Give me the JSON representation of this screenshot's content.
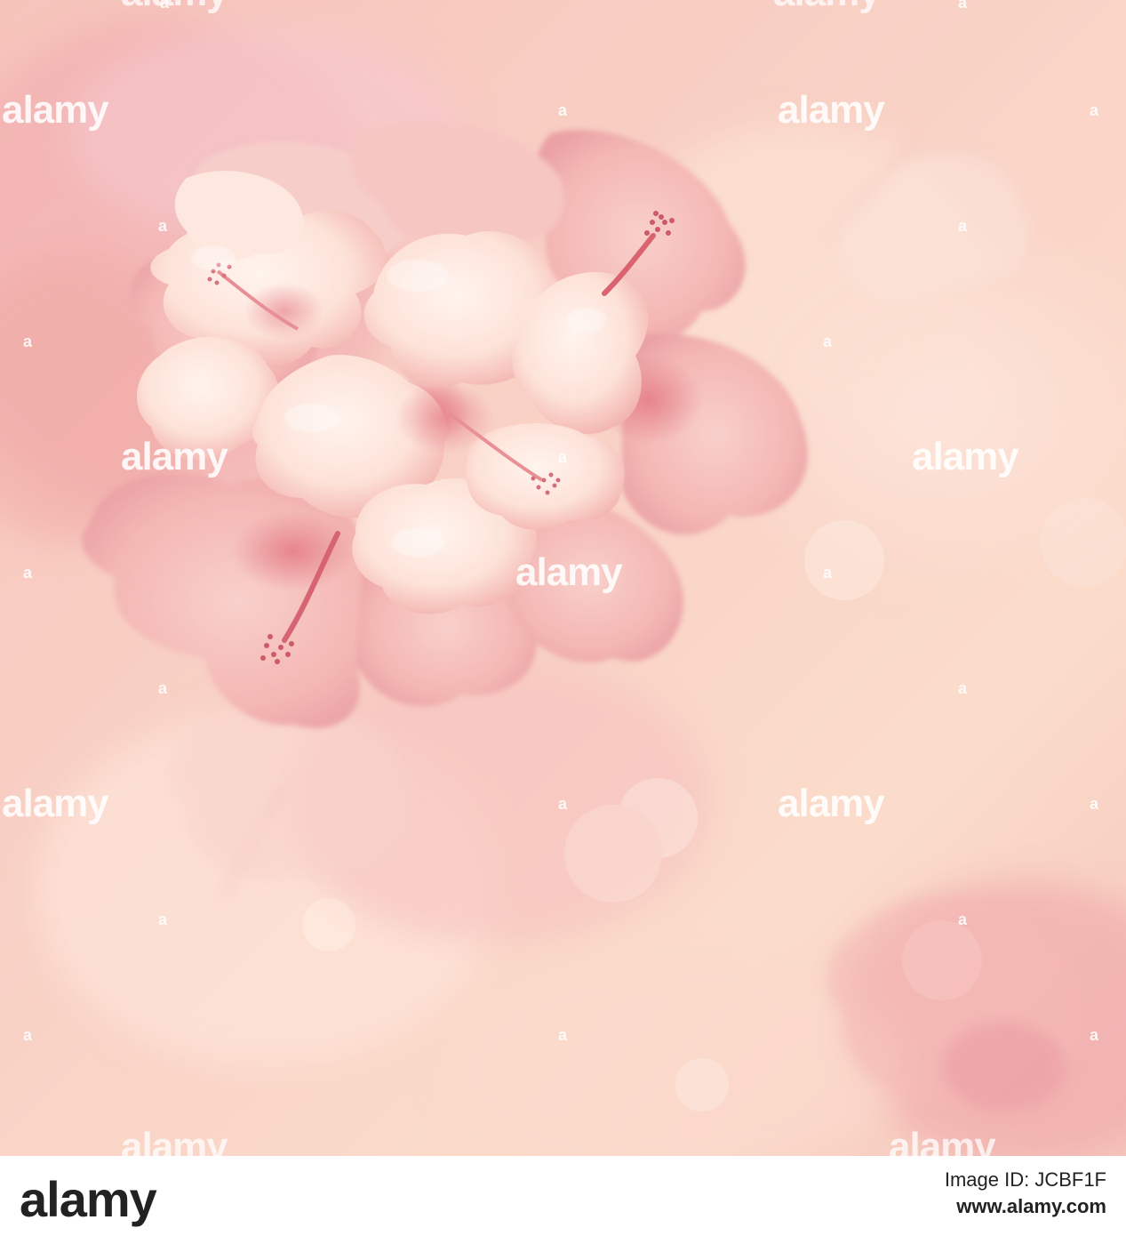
{
  "image": {
    "description_colors": {
      "background_light": "#fbdcc9",
      "background_pink": "#f3b9b2",
      "petal_light": "#fdeee6",
      "petal_shadow": "#e8a0a0",
      "stamen": "#d25a6a"
    }
  },
  "watermark": {
    "text": "alamy",
    "code": "a"
  },
  "footer": {
    "logo": "alamy",
    "id_label": "Image ID: JCBF1F",
    "id": "",
    "url": "www.alamy.com"
  }
}
